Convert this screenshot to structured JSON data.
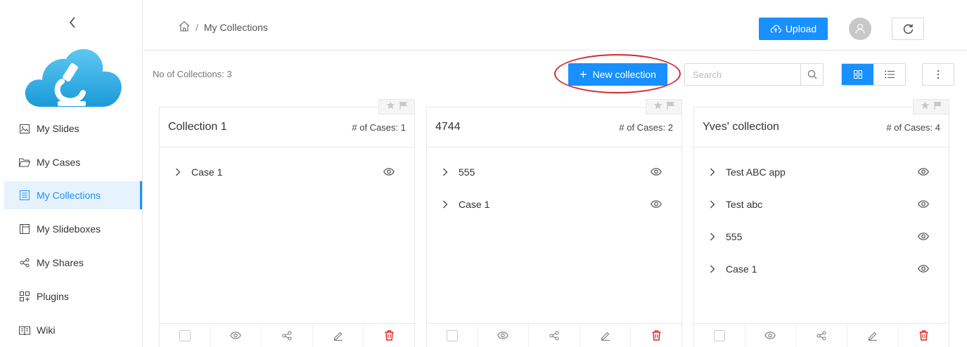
{
  "header": {
    "breadcrumb": {
      "home_icon": "home-icon",
      "separator": "/",
      "current": "My Collections"
    },
    "upload_label": "Upload",
    "avatar_icon": "user-icon",
    "refresh_icon": "refresh-icon"
  },
  "sidebar": {
    "collapse_icon": "chevron-left-icon",
    "items": [
      {
        "label": "My Slides",
        "icon": "image-icon",
        "active": false
      },
      {
        "label": "My Cases",
        "icon": "folder-icon",
        "active": false
      },
      {
        "label": "My Collections",
        "icon": "collection-icon",
        "active": true
      },
      {
        "label": "My Slideboxes",
        "icon": "slidebox-icon",
        "active": false
      },
      {
        "label": "My Shares",
        "icon": "share-icon",
        "active": false
      },
      {
        "label": "Plugins",
        "icon": "plugin-icon",
        "active": false
      },
      {
        "label": "Wiki",
        "icon": "book-icon",
        "active": false
      }
    ]
  },
  "toolbar": {
    "count_label": "No of Collections: 3",
    "new_collection_label": "New collection",
    "search_placeholder": "Search"
  },
  "collections": [
    {
      "title": "Collection 1",
      "count_label": "# of Cases: 1",
      "cases": [
        "Case 1"
      ]
    },
    {
      "title": "4744",
      "count_label": "# of Cases: 2",
      "cases": [
        "555",
        "Case 1"
      ]
    },
    {
      "title": "Yves' collection",
      "count_label": "# of Cases: 4",
      "cases": [
        "Test ABC app",
        "Test abc",
        "555",
        "Case 1"
      ]
    }
  ],
  "colors": {
    "accent": "#1890ff",
    "active_bg": "#e6f3fd",
    "delete": "#e02020",
    "highlight": "#d62a2a"
  }
}
